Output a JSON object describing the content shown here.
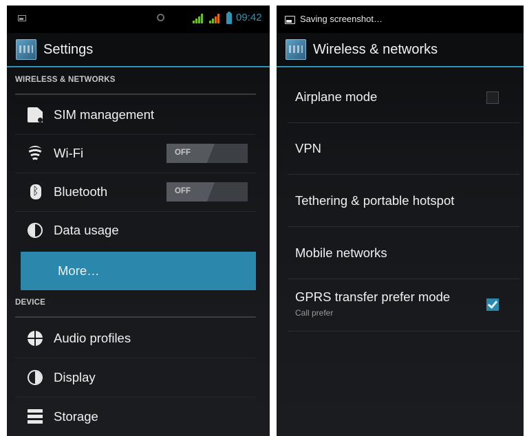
{
  "left_screen": {
    "statusbar": {
      "time": "09:42"
    },
    "actionbar": {
      "title": "Settings"
    },
    "sections": [
      {
        "title": "WIRELESS & NETWORKS"
      },
      {
        "title": "DEVICE"
      }
    ],
    "items": [
      {
        "label": "SIM management",
        "icon": "sim-card-icon"
      },
      {
        "label": "Wi-Fi",
        "icon": "wifi-icon",
        "toggle": "OFF"
      },
      {
        "label": "Bluetooth",
        "icon": "bluetooth-icon",
        "toggle": "OFF"
      },
      {
        "label": "Data usage",
        "icon": "data-usage-icon"
      },
      {
        "label": "More…",
        "selected": true
      },
      {
        "label": "Audio profiles",
        "icon": "audio-profiles-icon"
      },
      {
        "label": "Display",
        "icon": "display-icon"
      },
      {
        "label": "Storage",
        "icon": "storage-icon"
      }
    ]
  },
  "right_screen": {
    "statusbar": {
      "notice": "Saving screenshot…"
    },
    "actionbar": {
      "title": "Wireless & networks"
    },
    "items": [
      {
        "label": "Airplane mode",
        "checked": false
      },
      {
        "label": "VPN"
      },
      {
        "label": "Tethering & portable hotspot"
      },
      {
        "label": "Mobile networks"
      },
      {
        "label": "GPRS transfer prefer mode",
        "summary": "Call prefer",
        "checked": true
      }
    ]
  },
  "colors": {
    "accent": "#2f94b6",
    "selected_row": "#2b88ad",
    "background": "#1a1c20"
  }
}
